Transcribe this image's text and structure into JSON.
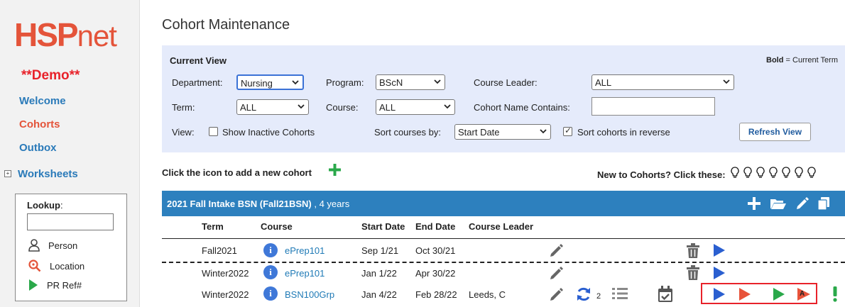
{
  "sidebar": {
    "logo": {
      "bold": "HSP",
      "light": "net"
    },
    "demo_label": "**Demo**",
    "nav": [
      {
        "label": "Welcome"
      },
      {
        "label": "Cohorts"
      },
      {
        "label": "Outbox"
      },
      {
        "label": "Worksheets"
      }
    ],
    "lookup": {
      "title": "Lookup",
      "colon": ":",
      "input_value": "",
      "items": [
        {
          "label": "Person",
          "icon": "person-icon"
        },
        {
          "label": "Location",
          "icon": "location-search-icon"
        },
        {
          "label": "PR Ref#",
          "icon": "play-green-icon"
        }
      ]
    }
  },
  "page": {
    "title": "Cohort Maintenance"
  },
  "current_view": {
    "title": "Current View",
    "legend_bold": "Bold",
    "legend_rest": " = Current Term",
    "department": {
      "label": "Department:",
      "value": "Nursing"
    },
    "program": {
      "label": "Program:",
      "value": "BScN"
    },
    "course_leader": {
      "label": "Course Leader:",
      "value": "ALL"
    },
    "term": {
      "label": "Term:",
      "value": "ALL"
    },
    "course": {
      "label": "Course:",
      "value": "ALL"
    },
    "cohort_name": {
      "label": "Cohort Name Contains:",
      "value": ""
    },
    "view_label": "View:",
    "show_inactive": {
      "label": "Show Inactive Cohorts",
      "checked": false
    },
    "sort_courses": {
      "label": "Sort courses by:",
      "value": "Start Date"
    },
    "sort_reverse": {
      "label": "Sort cohorts in reverse",
      "checked": true
    },
    "refresh_label": "Refresh View"
  },
  "add_hint": "Click the icon to add a new cohort",
  "new_hint": "New to Cohorts? Click these:",
  "bulbs": [
    "💡",
    "💡",
    "💡",
    "💡",
    "💡",
    "💡",
    "💡",
    "💡"
  ],
  "cohort": {
    "name": "2021 Fall Intake BSN (Fall21BSN)",
    "duration": " , 4 years",
    "columns": [
      "Term",
      "Course",
      "Start Date",
      "End Date",
      "Course Leader"
    ],
    "rows": [
      {
        "term": "Fall2021",
        "course": "ePrep101",
        "start": "Sep 1/21",
        "end": "Oct 30/21",
        "leader": ""
      },
      {
        "term": "Winter2022",
        "course": "ePrep101",
        "start": "Jan 1/22",
        "end": "Apr 30/22",
        "leader": ""
      },
      {
        "term": "Winter2022",
        "course": "BSN100Grp",
        "start": "Jan 4/22",
        "end": "Feb 28/22",
        "leader": "Leeds, C",
        "sync_count": "2"
      }
    ]
  },
  "colors": {
    "brand": "#e4543a",
    "link": "#2a7ab9",
    "panel": "#e5ebfb",
    "header": "#2d80be",
    "highlight": "#e8222a",
    "play_blue": "#2a5fd0",
    "play_red": "#e8533a",
    "play_green": "#2aa84a"
  }
}
